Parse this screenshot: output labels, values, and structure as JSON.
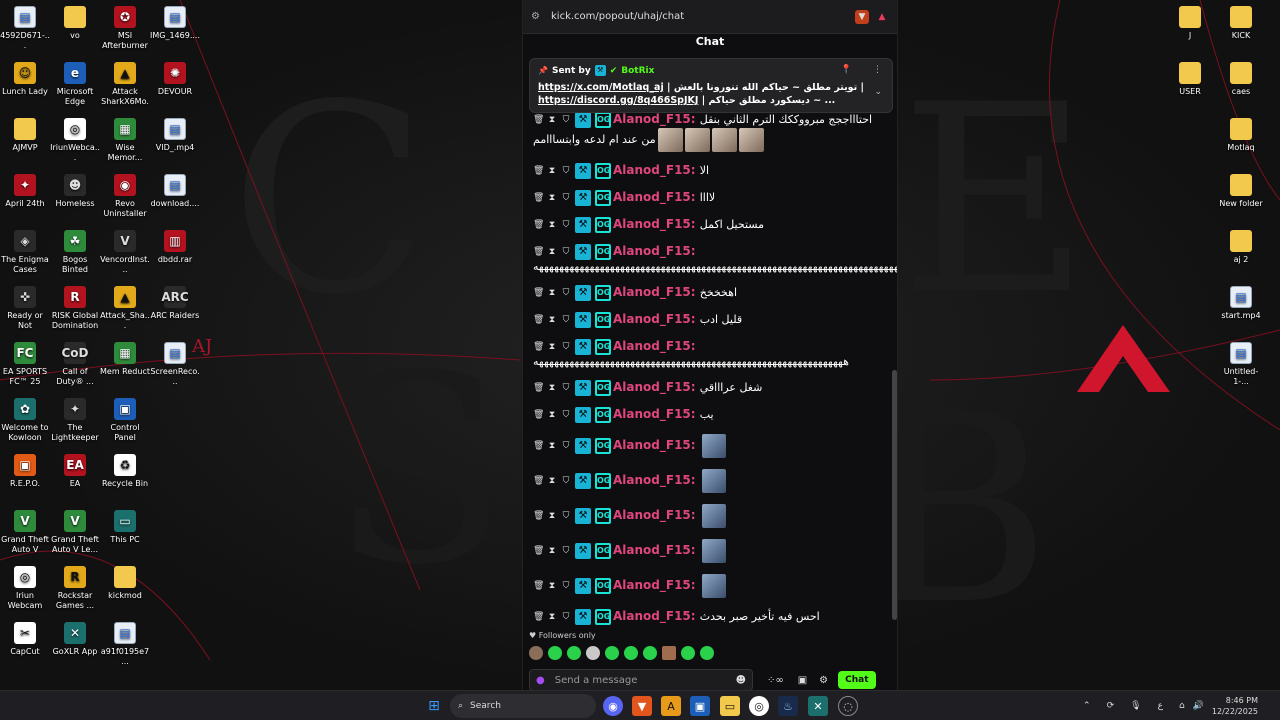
{
  "desktop": {
    "icons": [
      {
        "label": "4592D671-...",
        "glyph": "▤",
        "cls": "g-file"
      },
      {
        "label": "vo",
        "glyph": "",
        "cls": "g-folder"
      },
      {
        "label": "MSI Afterburner",
        "glyph": "✪",
        "cls": "g-red"
      },
      {
        "label": "IMG_1469....",
        "glyph": "▤",
        "cls": "g-file"
      },
      {
        "label": "Lunch Lady",
        "glyph": "☺",
        "cls": "g-yellow"
      },
      {
        "label": "Microsoft Edge",
        "glyph": "e",
        "cls": "g-blue"
      },
      {
        "label": "Attack SharkX6Mo...",
        "glyph": "▲",
        "cls": "g-yellow"
      },
      {
        "label": "DEVOUR",
        "glyph": "✺",
        "cls": "g-red"
      },
      {
        "label": "AJMVP",
        "glyph": "",
        "cls": "g-folder"
      },
      {
        "label": "IriunWebca...",
        "glyph": "◎",
        "cls": "g-white"
      },
      {
        "label": "Wise Memor...",
        "glyph": "▦",
        "cls": "g-green"
      },
      {
        "label": "VID_.mp4",
        "glyph": "▤",
        "cls": "g-file"
      },
      {
        "label": "April 24th",
        "glyph": "✦",
        "cls": "g-red"
      },
      {
        "label": "Homeless",
        "glyph": "☻",
        "cls": "g-app"
      },
      {
        "label": "Revo Uninstaller",
        "glyph": "◉",
        "cls": "g-red"
      },
      {
        "label": "download....",
        "glyph": "▤",
        "cls": "g-file"
      },
      {
        "label": "The Enigma Cases Demo",
        "glyph": "◈",
        "cls": "g-app"
      },
      {
        "label": "Bogos Binted",
        "glyph": "☘",
        "cls": "g-green"
      },
      {
        "label": "VencordInst...",
        "glyph": "V",
        "cls": "g-app"
      },
      {
        "label": "dbdd.rar",
        "glyph": "▥",
        "cls": "g-red"
      },
      {
        "label": "Ready or Not",
        "glyph": "✜",
        "cls": "g-app"
      },
      {
        "label": "RISK Global Domination",
        "glyph": "R",
        "cls": "g-red"
      },
      {
        "label": "Attack_Sha...",
        "glyph": "▲",
        "cls": "g-yellow"
      },
      {
        "label": "ARC Raiders",
        "glyph": "ARC",
        "cls": "g-app"
      },
      {
        "label": "EA SPORTS FC™ 25",
        "glyph": "FC",
        "cls": "g-green"
      },
      {
        "label": "Call of Duty® ...",
        "glyph": "CoD",
        "cls": "g-app"
      },
      {
        "label": "Mem Reduct",
        "glyph": "▦",
        "cls": "g-green"
      },
      {
        "label": "ScreenReco...",
        "glyph": "▤",
        "cls": "g-file"
      },
      {
        "label": "Welcome to Kowloon",
        "glyph": "✿",
        "cls": "g-teal"
      },
      {
        "label": "The Lightkeeper",
        "glyph": "✦",
        "cls": "g-app"
      },
      {
        "label": "Control Panel",
        "glyph": "▣",
        "cls": "g-blue"
      },
      {
        "label": "R.E.P.O.",
        "glyph": "▣",
        "cls": "g-orange"
      },
      {
        "label": "EA",
        "glyph": "EA",
        "cls": "g-red"
      },
      {
        "label": "Recycle Bin",
        "glyph": "♻",
        "cls": "g-white"
      },
      {
        "label": "Grand Theft Auto V",
        "glyph": "V",
        "cls": "g-green"
      },
      {
        "label": "Grand Theft Auto V Le...",
        "glyph": "V",
        "cls": "g-green"
      },
      {
        "label": "This PC",
        "glyph": "▭",
        "cls": "g-teal"
      },
      {
        "label": "Iriun Webcam",
        "glyph": "◎",
        "cls": "g-white"
      },
      {
        "label": "Rockstar Games ...",
        "glyph": "R",
        "cls": "g-yellow"
      },
      {
        "label": "kickmod",
        "glyph": "",
        "cls": "g-folder"
      },
      {
        "label": "CapCut",
        "glyph": "✂",
        "cls": "g-white"
      },
      {
        "label": "GoXLR App",
        "glyph": "✕",
        "cls": "g-teal"
      },
      {
        "label": "a91f0195e7...",
        "glyph": "▤",
        "cls": "g-file"
      },
      {
        "label": "J",
        "glyph": "",
        "cls": "g-folder"
      },
      {
        "label": "KICK",
        "glyph": "",
        "cls": "g-folder"
      },
      {
        "label": "USER",
        "glyph": "",
        "cls": "g-folder"
      },
      {
        "label": "caes",
        "glyph": "",
        "cls": "g-folder"
      },
      {
        "label": "Motlaq",
        "glyph": "",
        "cls": "g-folder"
      },
      {
        "label": "New folder",
        "glyph": "",
        "cls": "g-folder"
      },
      {
        "label": "aj 2",
        "glyph": "",
        "cls": "g-folder"
      },
      {
        "label": "start.mp4",
        "glyph": "▤",
        "cls": "g-file"
      },
      {
        "label": "Untitled-1-...",
        "glyph": "▤",
        "cls": "g-file"
      }
    ],
    "wallpaper_logo_text": "AJ"
  },
  "browser": {
    "url": "kick.com/popout/uhaj/chat"
  },
  "chat": {
    "header": "Chat",
    "pinned": {
      "sent_by_label": "Sent by",
      "sender": "BotRix",
      "line1_link": "https://x.com/Motlaq_aj",
      "line1_text": "| تويتر مطلق ~ حياكم الله تنورونا بالعش |",
      "line2_link": "https://discord.gg/8q466SpJKJ",
      "line2_text": "| ديسكورد مطلق حياكم ~ ..."
    },
    "messages": [
      {
        "user": "Alanod_F15",
        "text": "احتاااججج مبرووككك الترم الثاني بنقل من عند ام لدعه وابتسااامم",
        "emotes": 4
      },
      {
        "user": "Alanod_F15",
        "text": "الا",
        "emotes": 0
      },
      {
        "user": "Alanod_F15",
        "text": "لاااا",
        "emotes": 0
      },
      {
        "user": "Alanod_F15",
        "text": "مستحيل اكمل",
        "emotes": 0
      },
      {
        "user": "Alanod_F15",
        "text": "هههههههههههههههههههههههههههههههههههههههههههههههههههههههههههههههههههههههههههههه",
        "emotes": 0
      },
      {
        "user": "Alanod_F15",
        "text": "اهخخخخ",
        "emotes": 0
      },
      {
        "user": "Alanod_F15",
        "text": "قليل ادب",
        "emotes": 0
      },
      {
        "user": "Alanod_F15",
        "text": "هههههههههههههههههههههههههههههههههههههههههههههههههههههههههههههه",
        "emotes": 0
      },
      {
        "user": "Alanod_F15",
        "text": "شغل عراااقي",
        "emotes": 0
      },
      {
        "user": "Alanod_F15",
        "text": "يب",
        "emotes": 0
      },
      {
        "user": "Alanod_F15",
        "text": "",
        "emotes": 1
      },
      {
        "user": "Alanod_F15",
        "text": "",
        "emotes": 1
      },
      {
        "user": "Alanod_F15",
        "text": "",
        "emotes": 1
      },
      {
        "user": "Alanod_F15",
        "text": "",
        "emotes": 1
      },
      {
        "user": "Alanod_F15",
        "text": "",
        "emotes": 1
      },
      {
        "user": "Alanod_F15",
        "text": "احس فيه تأخير صبر بحدث",
        "emotes": 0
      }
    ],
    "followers_only_label": "Followers only",
    "input_placeholder": "Send a message",
    "send_label": "Chat",
    "badge_og_text": "OG"
  },
  "taskbar": {
    "search_label": "Search",
    "time": "8:46 PM",
    "date": "12/22/2025",
    "lang": "ع"
  },
  "colors": {
    "kick_green": "#53fc18",
    "username_pink": "#e0467e",
    "mod_badge": "#19b3d6"
  }
}
